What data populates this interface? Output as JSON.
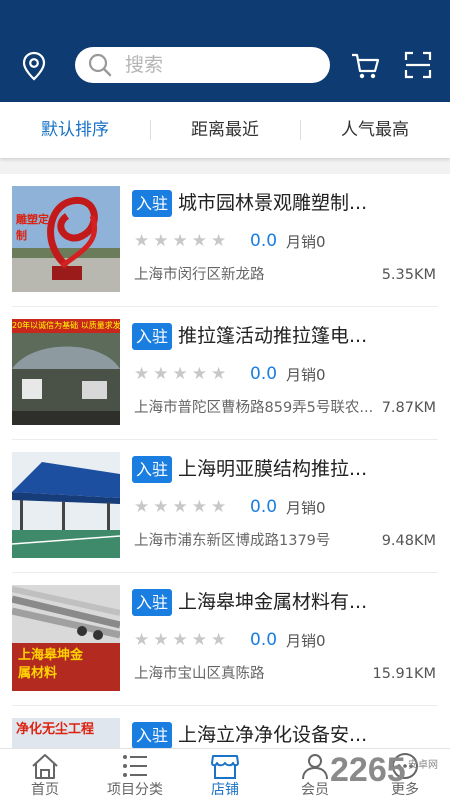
{
  "header": {
    "search_placeholder": "搜索",
    "icons": [
      "location-icon",
      "search-icon",
      "cart-icon",
      "scan-icon"
    ],
    "bg_color": "#0d3b72"
  },
  "sort_tabs": [
    {
      "label": "默认排序",
      "active": true
    },
    {
      "label": "距离最近",
      "active": false
    },
    {
      "label": "人气最高",
      "active": false
    }
  ],
  "shops": [
    {
      "badge": "入驻",
      "title": "城市园林景观雕塑制...",
      "stars": "★★★★★",
      "rating": "0.0",
      "sales": "月销0",
      "address": "上海市闵行区新龙路",
      "distance": "5.35KM",
      "thumb_text": "雕塑定制"
    },
    {
      "badge": "入驻",
      "title": "推拉篷活动推拉篷电...",
      "stars": "★★★★★",
      "rating": "0.0",
      "sales": "月销0",
      "address": "上海市普陀区曹杨路859弄5号联农...",
      "distance": "7.87KM",
      "thumb_text": "20年以诚信为基础 以质量求发展"
    },
    {
      "badge": "入驻",
      "title": "上海明亚膜结构推拉...",
      "stars": "★★★★★",
      "rating": "0.0",
      "sales": "月销0",
      "address": "上海市浦东新区博成路1379号",
      "distance": "9.48KM",
      "thumb_text": ""
    },
    {
      "badge": "入驻",
      "title": "上海皋坤金属材料有...",
      "stars": "★★★★★",
      "rating": "0.0",
      "sales": "月销0",
      "address": "上海市宝山区真陈路",
      "distance": "15.91KM",
      "thumb_text": "上海皋坤金属材料"
    },
    {
      "badge": "入驻",
      "title": "上海立净净化设备安...",
      "stars": "",
      "rating": "",
      "sales": "",
      "address": "",
      "distance": "",
      "thumb_text": "净化无尘工程"
    }
  ],
  "tabbar": [
    {
      "label": "首页",
      "icon": "home-icon",
      "active": false
    },
    {
      "label": "项目分类",
      "icon": "list-icon",
      "active": false
    },
    {
      "label": "店铺",
      "icon": "store-icon",
      "active": true
    },
    {
      "label": "会员",
      "icon": "user-icon",
      "active": false
    },
    {
      "label": "更多",
      "icon": "more-icon",
      "active": false
    }
  ],
  "watermark": {
    "text": "2265",
    "sub": "安卓网"
  }
}
